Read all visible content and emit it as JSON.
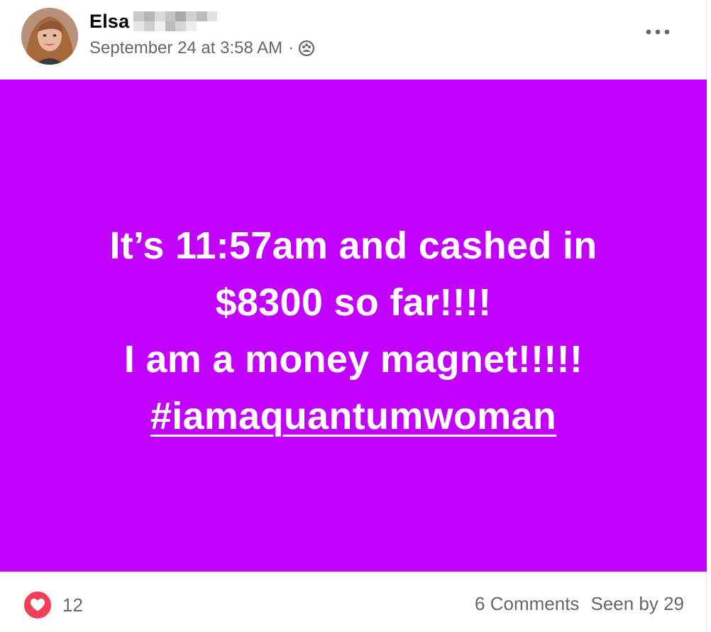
{
  "post": {
    "author_first_name": "Elsa",
    "timestamp": "September 24 at 3:58 AM",
    "separator": "·",
    "audience_icon": "group-audience-icon",
    "more_icon": "more-options-icon",
    "text_lines": [
      "It’s 11:57am and cashed in",
      "$8300 so far!!!!",
      "I am a money magnet!!!!!"
    ],
    "hashtag": "#iamaquantumwoman",
    "background_color": "#c100fd",
    "text_color": "#ffffff"
  },
  "footer": {
    "reaction_icon": "love-reaction-icon",
    "reaction_count": "12",
    "comments": "6 Comments",
    "seen_by": "Seen by 29"
  }
}
